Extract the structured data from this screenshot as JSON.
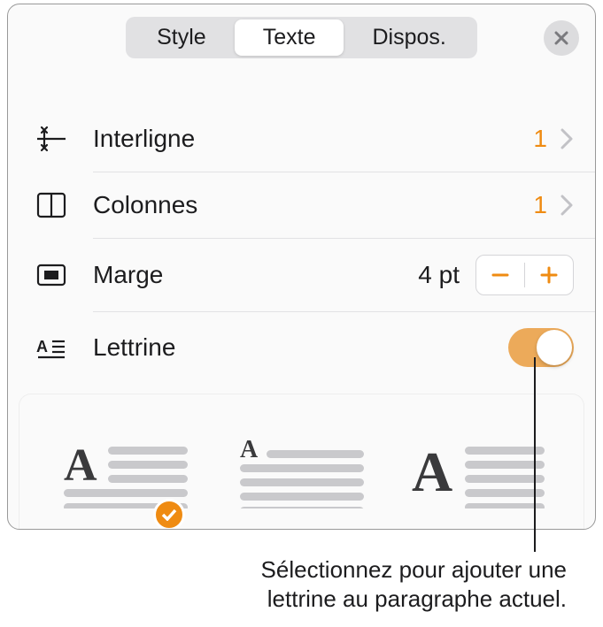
{
  "tabs": {
    "style": "Style",
    "text": "Texte",
    "layout": "Dispos."
  },
  "rows": {
    "lineSpacing": {
      "label": "Interligne",
      "value": "1"
    },
    "columns": {
      "label": "Colonnes",
      "value": "1"
    },
    "margin": {
      "label": "Marge",
      "value": "4 pt"
    },
    "dropCap": {
      "label": "Lettrine"
    }
  },
  "caption": {
    "line1": "Sélectionnez pour ajouter une",
    "line2": "lettrine au paragraphe actuel."
  }
}
